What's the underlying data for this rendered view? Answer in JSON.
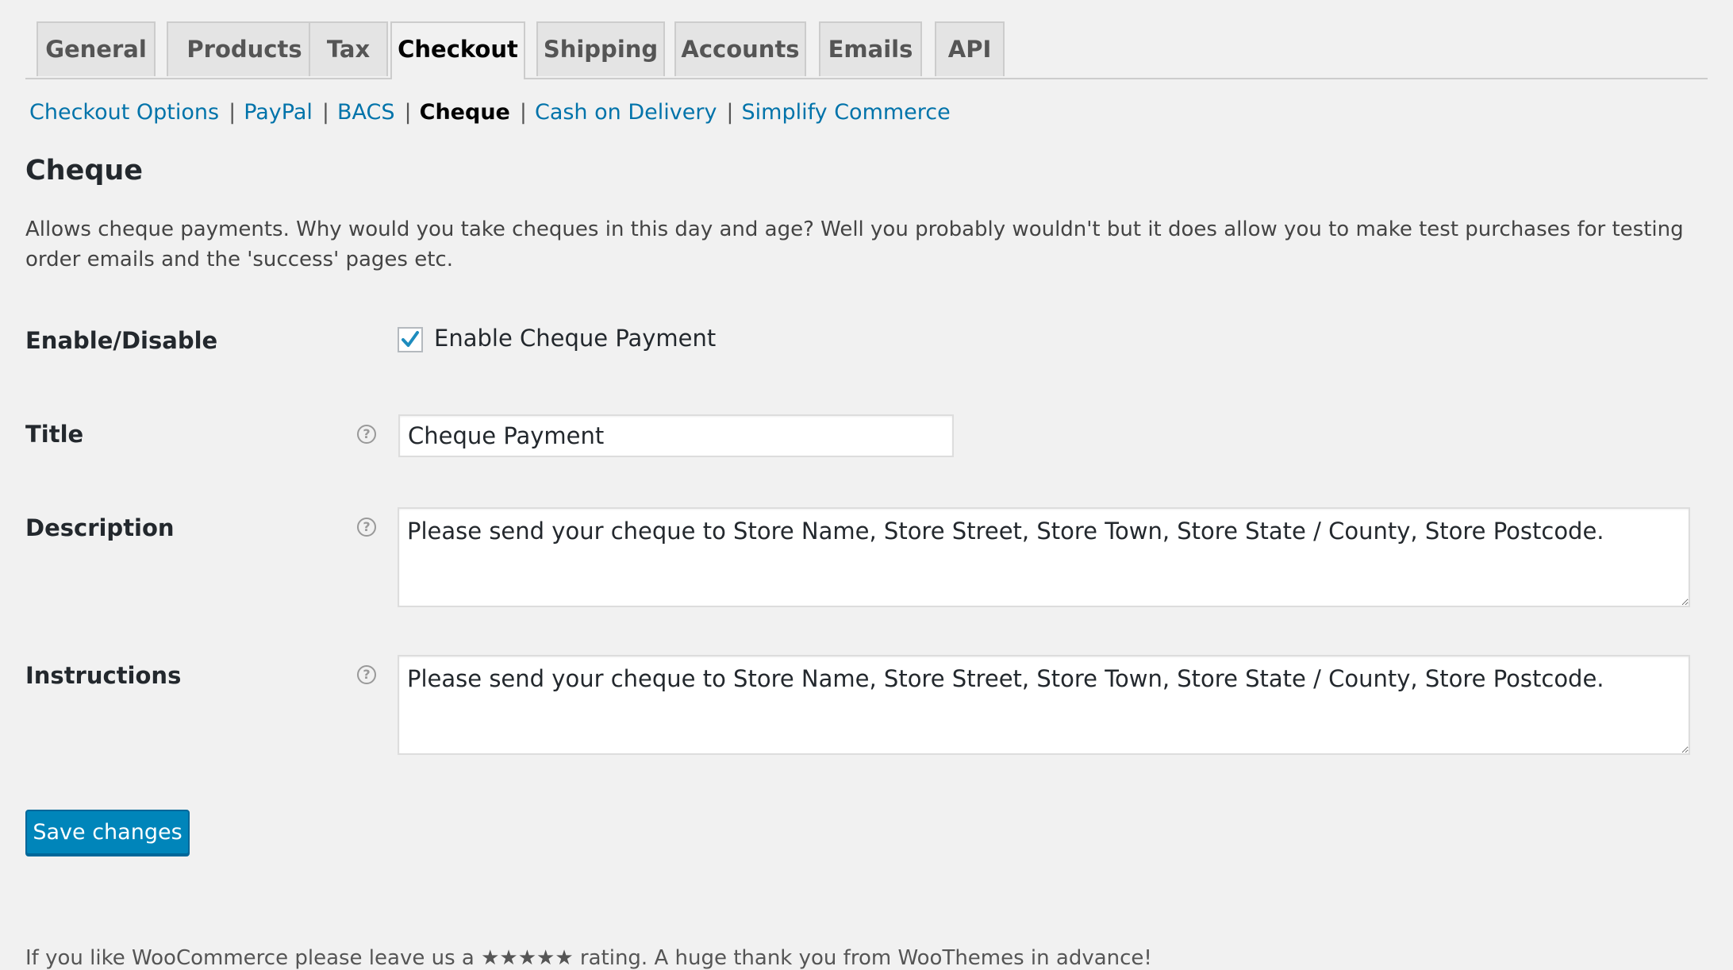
{
  "tabs": [
    {
      "label": "General",
      "active": false
    },
    {
      "label": "Products",
      "active": false
    },
    {
      "label": "Tax",
      "active": false
    },
    {
      "label": "Checkout",
      "active": true
    },
    {
      "label": "Shipping",
      "active": false
    },
    {
      "label": "Accounts",
      "active": false
    },
    {
      "label": "Emails",
      "active": false
    },
    {
      "label": "API",
      "active": false
    }
  ],
  "subnav": {
    "items": [
      {
        "label": "Checkout Options"
      },
      {
        "label": "PayPal"
      },
      {
        "label": "BACS"
      },
      {
        "label": "Cheque",
        "current": true
      },
      {
        "label": "Cash on Delivery"
      },
      {
        "label": "Simplify Commerce"
      }
    ],
    "separator": "|"
  },
  "section": {
    "title": "Cheque",
    "description": "Allows cheque payments. Why would you take cheques in this day and age? Well you probably wouldn't but it does allow you to make test purchases for testing order emails and the 'success' pages etc."
  },
  "form": {
    "enable": {
      "label": "Enable/Disable",
      "checkbox_label": "Enable Cheque Payment",
      "checked": true
    },
    "title": {
      "label": "Title",
      "value": "Cheque Payment"
    },
    "description": {
      "label": "Description",
      "value": "Please send your cheque to Store Name, Store Street, Store Town, Store State / County, Store Postcode."
    },
    "instructions": {
      "label": "Instructions",
      "value": "Please send your cheque to Store Name, Store Street, Store Town, Store State / County, Store Postcode."
    },
    "help_icon": "question-circle-icon",
    "help_glyph": "?"
  },
  "actions": {
    "save_label": "Save changes"
  },
  "footer": {
    "text": "If you like WooCommerce please leave us a ★★★★★ rating. A huge thank you from WooThemes in advance!"
  },
  "colors": {
    "link": "#0073aa",
    "primary_button": "#0085ba",
    "checkmark": "#1e8cbe"
  }
}
